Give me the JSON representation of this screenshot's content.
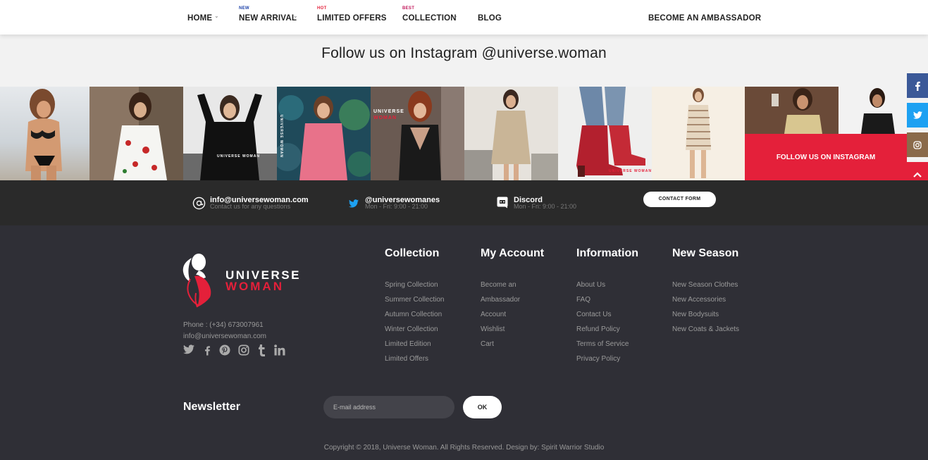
{
  "nav": {
    "items": [
      {
        "label": "HOME",
        "badge": "",
        "has_dropdown": true
      },
      {
        "label": "NEW ARRIVAL",
        "badge": "NEW",
        "badge_color": "#1a3fa8",
        "has_dropdown": true
      },
      {
        "label": "LIMITED OFFERS",
        "badge": "HOT",
        "badge_color": "#e4203a",
        "has_dropdown": true
      },
      {
        "label": "COLLECTION",
        "badge": "BEST",
        "badge_color": "#c2185b",
        "has_dropdown": true
      },
      {
        "label": "BLOG",
        "badge": "",
        "has_dropdown": false
      }
    ],
    "ambassador": "BECOME AN AMBASSADOR"
  },
  "instagram": {
    "title": "Follow us on Instagram @universe.woman",
    "follow_button": "FOLLOW US ON INSTAGRAM",
    "photo_overlays": {
      "p3": "UNIVERSE WOMAN",
      "p4": "UNIVERSE WOMAN",
      "p5_line1": "UNIVERSE",
      "p5_line2": "WOMAN",
      "p8": "UNIVERSE WOMAN"
    }
  },
  "side_social": [
    "facebook-icon",
    "twitter-icon",
    "instagram-icon",
    "arrow-up-icon"
  ],
  "contact": {
    "email_title": "info@universewoman.com",
    "email_sub": "Contact us for any questions",
    "twitter_title": "@universewomanes",
    "twitter_sub": "Mon - Fri: 9:00 - 21:00",
    "discord_title": "Discord",
    "discord_sub": "Mon - Fri: 9:00 - 21:00",
    "form_button": "CONTACT FORM"
  },
  "footer": {
    "brand_line1": "UNIVERSE",
    "brand_line2": "WOMAN",
    "phone": "Phone : (+34) 673007961",
    "email": "info@universewoman.com",
    "socials": [
      "twitter-icon",
      "facebook-icon",
      "pinterest-icon",
      "instagram-icon",
      "tumblr-icon",
      "linkedin-icon"
    ],
    "columns": [
      {
        "title": "Collection",
        "links": [
          "Spring Collection",
          "Summer Collection",
          "Autumn Collection",
          "Winter Collection",
          "Limited Edition",
          "Limited Offers"
        ]
      },
      {
        "title": "My Account",
        "links": [
          "Become an",
          "Ambassador",
          "Account",
          "Wishlist",
          "Cart"
        ]
      },
      {
        "title": "Information",
        "links": [
          "About Us",
          "FAQ",
          "Contact Us",
          "Refund Policy",
          "Terms of Service",
          "Privacy Policy"
        ]
      },
      {
        "title": "New Season",
        "links": [
          "New Season Clothes",
          "New Accessories",
          "New Bodysuits",
          "New Coats & Jackets"
        ]
      }
    ],
    "newsletter_label": "Newsletter",
    "newsletter_placeholder": "E-mail address",
    "newsletter_button": "OK",
    "copyright": "Copyright © 2018, Universe Woman. All Rights Reserved. Design by: Spirit Warrior Studio"
  },
  "colors": {
    "accent": "#e4203a",
    "footer_bg": "#2f2f36",
    "contact_bg": "#2a2a2a",
    "facebook": "#3b5998",
    "twitter": "#1da1f2",
    "instagram": "#8a6a4a"
  }
}
